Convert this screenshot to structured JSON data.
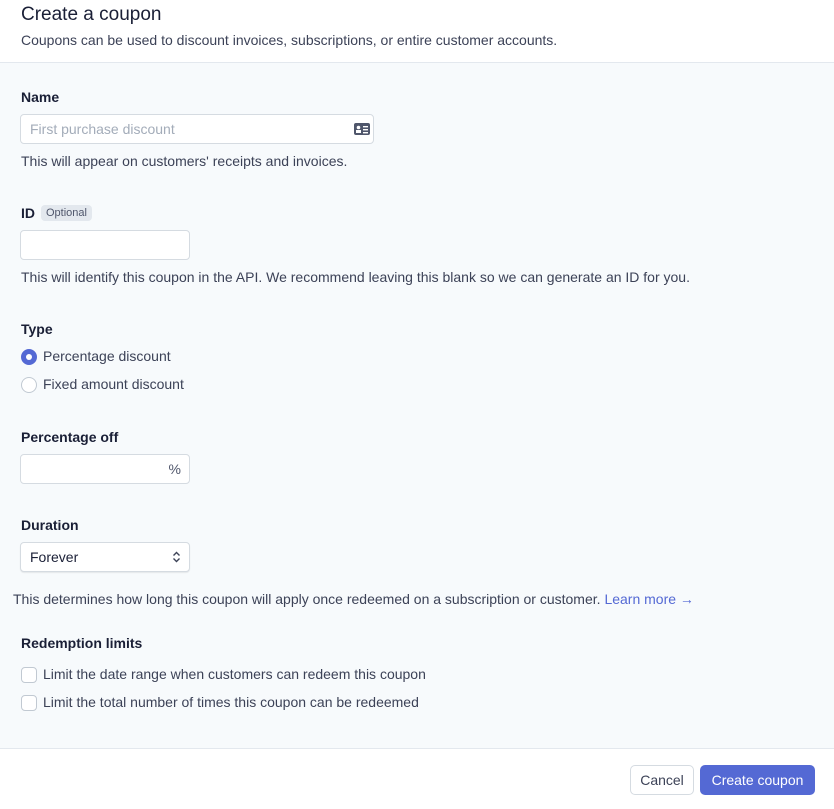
{
  "header": {
    "title": "Create a coupon",
    "subtitle": "Coupons can be used to discount invoices, subscriptions, or entire customer accounts."
  },
  "name": {
    "label": "Name",
    "placeholder": "First purchase discount",
    "value": "",
    "help": "This will appear on customers' receipts and invoices.",
    "icon": "contact-card-icon"
  },
  "id": {
    "label": "ID",
    "badge": "Optional",
    "value": "",
    "help": "This will identify this coupon in the API. We recommend leaving this blank so we can generate an ID for you."
  },
  "type": {
    "label": "Type",
    "options": [
      {
        "label": "Percentage discount",
        "selected": true
      },
      {
        "label": "Fixed amount discount",
        "selected": false
      }
    ]
  },
  "percentage": {
    "label": "Percentage off",
    "value": "",
    "suffix": "%"
  },
  "duration": {
    "label": "Duration",
    "selected": "Forever",
    "help": "This determines how long this coupon will apply once redeemed on a subscription or customer.",
    "link": "Learn more →"
  },
  "limits": {
    "label": "Redemption limits",
    "options": [
      {
        "label": "Limit the date range when customers can redeem this coupon",
        "checked": false
      },
      {
        "label": "Limit the total number of times this coupon can be redeemed",
        "checked": false
      }
    ]
  },
  "footer": {
    "cancel": "Cancel",
    "create": "Create coupon"
  },
  "colors": {
    "accent": "#5469d4"
  }
}
